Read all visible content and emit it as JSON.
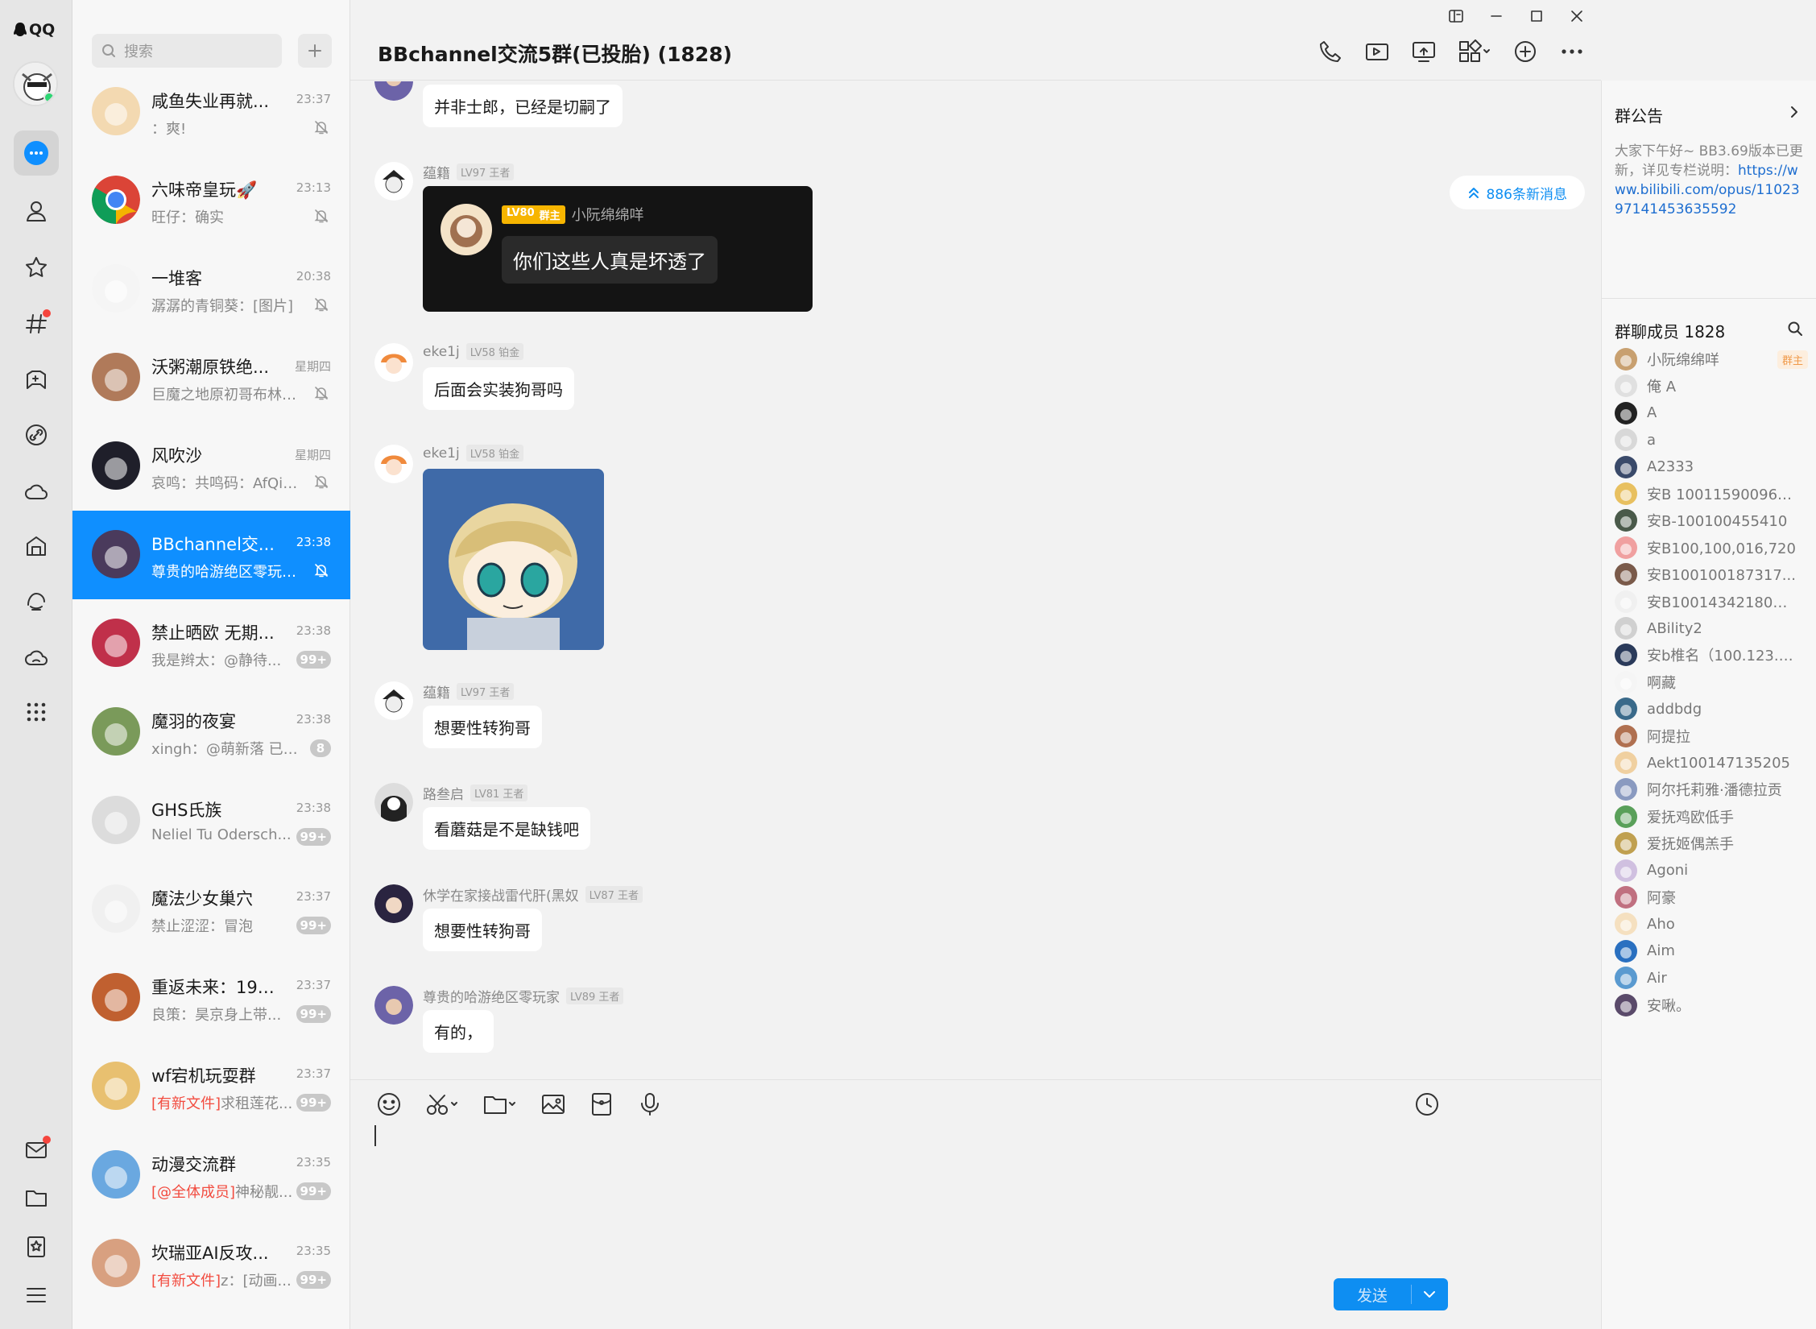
{
  "app": {
    "logo_text": "QQ"
  },
  "colors": {
    "accent": "#0f8fff",
    "badge": "#c8c8c8",
    "online": "#2ed573",
    "dot": "#f5453d"
  },
  "rail": {
    "items": [
      "message-icon",
      "contacts-icon",
      "favorites-icon",
      "channels-icon",
      "games-icon",
      "link-icon",
      "weather-icon",
      "home-icon",
      "tencent-icon",
      "cloud-icon",
      "apps-icon"
    ],
    "bottom": [
      "mail-icon",
      "folder-icon",
      "bookmark-icon",
      "menu-icon"
    ]
  },
  "search": {
    "placeholder": "搜索"
  },
  "conversations": [
    {
      "name": "咸鱼失业再就...",
      "time": "23:37",
      "preview": "：爽!",
      "muted": true
    },
    {
      "name": "六味帝皇玩🚀",
      "time": "23:13",
      "preview": "旺仔：确实",
      "muted": true
    },
    {
      "name": "一堆客",
      "time": "20:38",
      "preview": "潺潺的青铜葵：[图片]",
      "muted": true
    },
    {
      "name": "沃粥潮原铁绝...",
      "time": "星期四",
      "preview": "巨魔之地原初哥布林：...",
      "muted": true
    },
    {
      "name": "风吹沙",
      "time": "星期四",
      "preview": "哀鸣：共鸣码：AfQiJA...",
      "muted": true
    },
    {
      "name": "BBchannel交...",
      "time": "23:38",
      "preview": "尊贵的哈游绝区零玩家...",
      "muted": true,
      "selected": true
    },
    {
      "name": "禁止晒欧  无期...",
      "time": "23:38",
      "preview": "我是辫太：@静待...",
      "badge": "99+"
    },
    {
      "name": "魔羽的夜宴",
      "time": "23:38",
      "preview": "xingh：@萌新落 已经...",
      "badge": "8"
    },
    {
      "name": "GHS氏族",
      "time": "23:38",
      "preview": "Neliel Tu Odersch...",
      "badge": "99+"
    },
    {
      "name": "魔法少女巢穴",
      "time": "23:37",
      "preview": "禁止涩涩：冒泡",
      "badge": "99+"
    },
    {
      "name": "重返未来：199...",
      "time": "23:37",
      "preview": "良策：昊京身上带...",
      "badge": "99+"
    },
    {
      "name": "wf宕机玩耍群",
      "time": "23:37",
      "preview_tag": "[有新文件]",
      "preview": "求租莲花...",
      "badge": "99+"
    },
    {
      "name": "动漫交流群",
      "time": "23:35",
      "preview_tag": "[@全体成员]",
      "preview": "神秘靓...",
      "badge": "99+"
    },
    {
      "name": "坎瑞亚AI反攻...",
      "time": "23:35",
      "preview_tag": "[有新文件]",
      "preview": "z：[动画...",
      "badge": "99+"
    }
  ],
  "chat": {
    "title": "BBchannel交流5群(已投胎) (1828)",
    "new_messages": "886条新消息",
    "messages": [
      {
        "name": "",
        "level": "",
        "text": "并非士郎，已经是切嗣了"
      },
      {
        "name": "蕴籍",
        "level": "LV97 王者",
        "card": {
          "level": "LV80",
          "role": "群主",
          "user": "小阮绵绵咩",
          "text": "你们这些人真是坏透了"
        }
      },
      {
        "name": "eke1j",
        "level": "LV58 铂金",
        "text": "后面会实装狗哥吗"
      },
      {
        "name": "eke1j",
        "level": "LV58 铂金",
        "image": "saber-sticker"
      },
      {
        "name": "蕴籍",
        "level": "LV97 王者",
        "text": "想要性转狗哥"
      },
      {
        "name": "路叁启",
        "level": "LV81 王者",
        "text": "看蘑菇是不是缺钱吧"
      },
      {
        "name": "休学在家接战雷代肝(黑奴",
        "level": "LV87 王者",
        "text": "想要性转狗哥"
      },
      {
        "name": "尊贵的哈游绝区零玩家",
        "level": "LV89 王者",
        "text": "有的，"
      }
    ],
    "send_label": "发送"
  },
  "side": {
    "announcement_title": "群公告",
    "announcement_text": "大家下午好~ BB3.69版本已更新，详见专栏说明：",
    "announcement_link": "https://www.bilibili.com/opus/1102397141453635592",
    "members_title": "群聊成员 1828",
    "owner_tag": "群主",
    "members": [
      "小阮绵绵咩",
      "俺  A",
      "A",
      "a",
      "A2333",
      "安B 100115900961 ...",
      "安B-100100455410",
      "安B100,100,016,720",
      "安B100100187317...",
      "安B100143421800 ...",
      "ABility2",
      "安b椎名（100.123.8...",
      "啊藏",
      "addbdg",
      "阿提拉",
      "Aekt100147135205",
      "阿尔托莉雅·潘德拉贡",
      "爱抚鸡欧低手",
      "爱抚姬偶羔手",
      "Agoni",
      "阿豪",
      "Aho",
      "Aim",
      "Air",
      "安啾。"
    ]
  }
}
